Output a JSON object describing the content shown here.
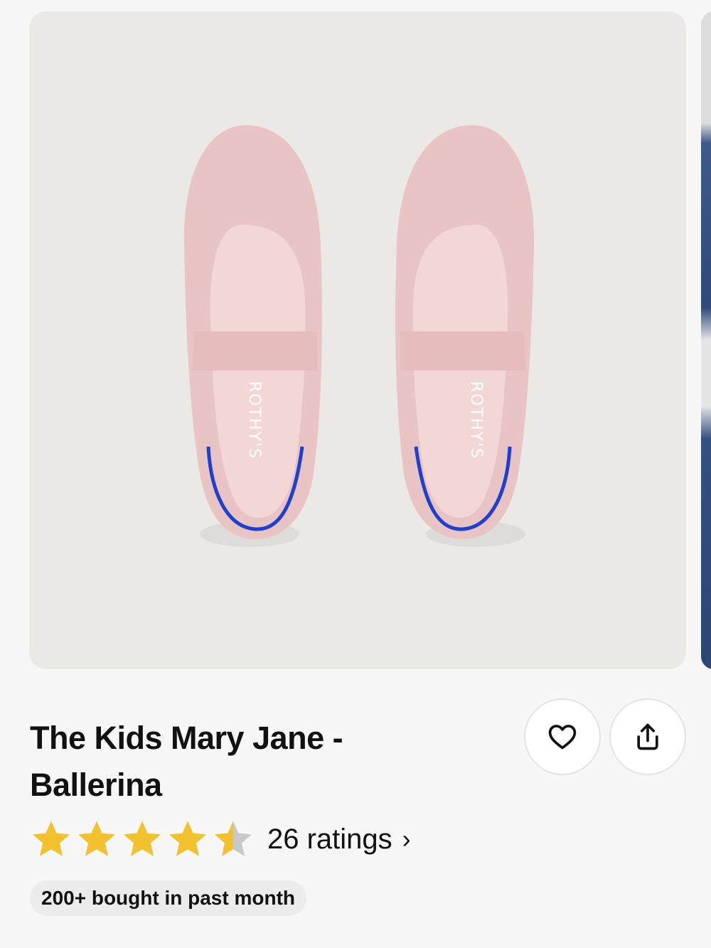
{
  "product": {
    "title": "The Kids Mary Jane - Ballerina",
    "image_brand_mark": "ROTHY'S",
    "image_colors": {
      "background": "#ebe9e6",
      "shoe": "#e8c5c4",
      "insole": "#f2d7d4",
      "accent_piping": "#1f3fcf"
    },
    "rating": {
      "stars": 4.5,
      "max_stars": 5,
      "count_label": "26 ratings",
      "chevron": "›"
    },
    "badge": "200+ bought in past month"
  },
  "actions": {
    "favorite_icon": "heart-icon",
    "share_icon": "share-icon"
  },
  "colors": {
    "star_filled": "#f2c12e",
    "star_empty": "#c9c9c9"
  }
}
